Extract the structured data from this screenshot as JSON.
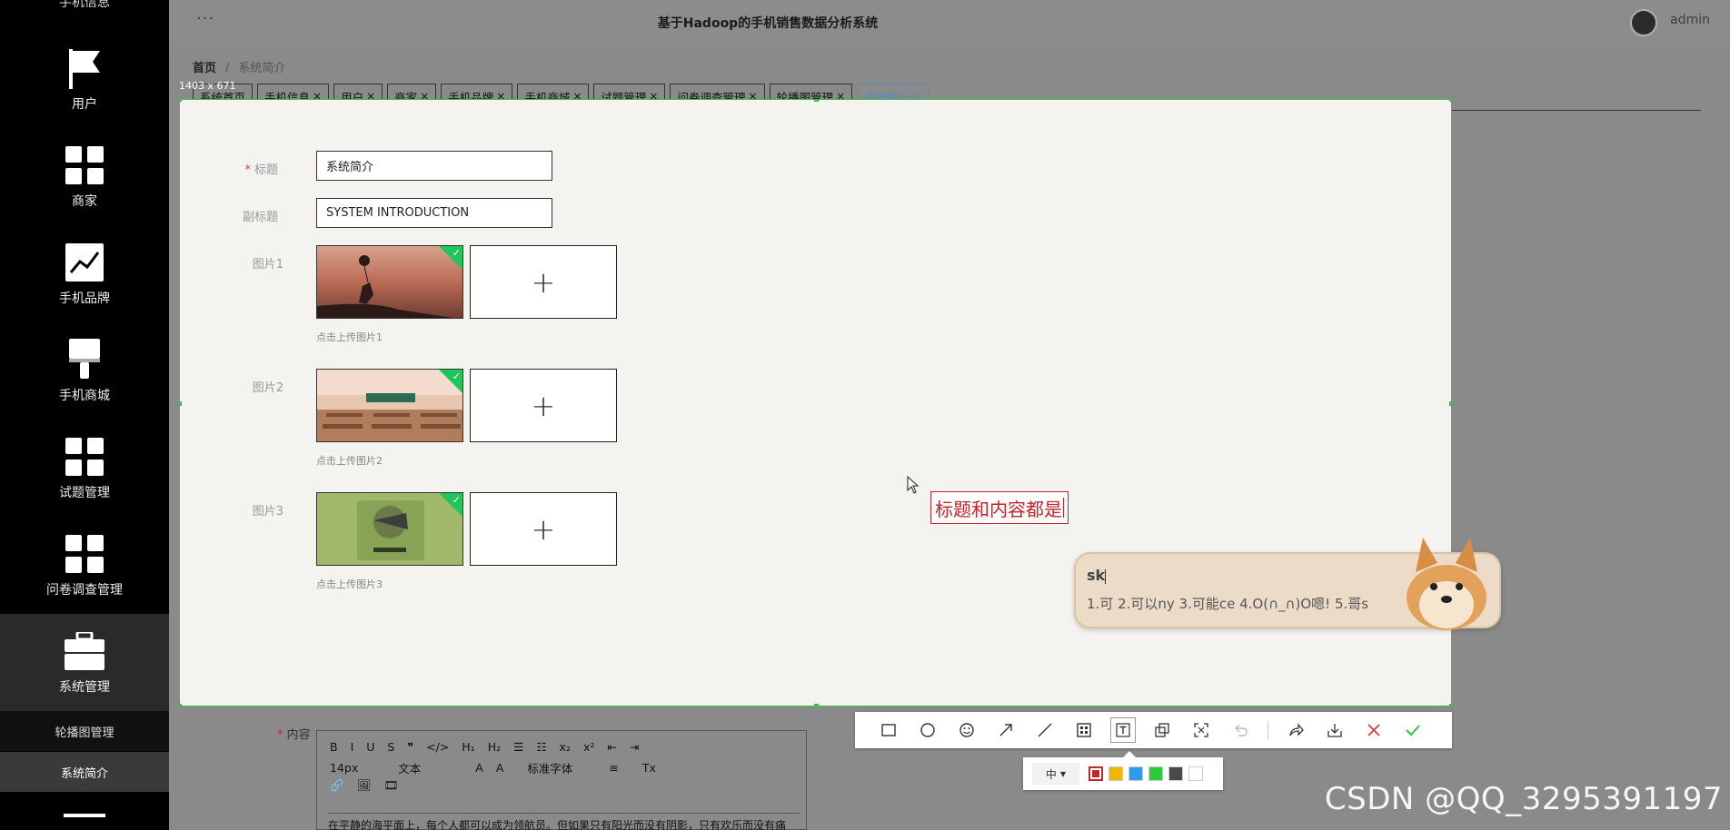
{
  "sidebar": {
    "top_cut_text": "手机信息",
    "items": [
      {
        "label": "用户",
        "icon": "flag-icon"
      },
      {
        "label": "商家",
        "icon": "grid-icon"
      },
      {
        "label": "手机品牌",
        "icon": "chart-icon"
      },
      {
        "label": "手机商城",
        "icon": "brush-icon"
      },
      {
        "label": "试题管理",
        "icon": "grid-icon"
      },
      {
        "label": "问卷调查管理",
        "icon": "grid-icon"
      },
      {
        "label": "系统管理",
        "icon": "briefcase-icon"
      }
    ],
    "subitems": [
      {
        "label": "轮播图管理"
      },
      {
        "label": "系统简介"
      }
    ]
  },
  "header": {
    "menu_dots": "···",
    "title": "基于Hadoop的手机销售数据分析系统",
    "user": "admin"
  },
  "breadcrumb": {
    "home": "首页",
    "sep": "/",
    "current": "系统简介"
  },
  "tabs": [
    {
      "label": "系统首页",
      "closable": false
    },
    {
      "label": "手机信息",
      "closable": true
    },
    {
      "label": "用户",
      "closable": true
    },
    {
      "label": "商家",
      "closable": true
    },
    {
      "label": "手机品牌",
      "closable": true
    },
    {
      "label": "手机商城",
      "closable": true
    },
    {
      "label": "试题管理",
      "closable": true
    },
    {
      "label": "问卷调查管理",
      "closable": true
    },
    {
      "label": "轮播图管理",
      "closable": true
    },
    {
      "label": "系统简介",
      "closable": true,
      "active": true
    }
  ],
  "close_glyph": "×",
  "selection_size": "1403 x 671",
  "form": {
    "title_label": "标题",
    "title_value": "系统简介",
    "subtitle_label": "副标题",
    "subtitle_value": "SYSTEM INTRODUCTION",
    "pictures": [
      {
        "label": "图片1",
        "hint": "点击上传图片1",
        "thumb": "silhouette-girl-balloon-sunset"
      },
      {
        "label": "图片2",
        "hint": "点击上传图片2",
        "thumb": "empty-classroom"
      },
      {
        "label": "图片3",
        "hint": "点击上传图片3",
        "thumb": "green-book-cover"
      }
    ],
    "plus": "+",
    "required_mark": "*",
    "content_label": "内容"
  },
  "annotation_text": "标题和内容都是",
  "ime": {
    "composition": "sk",
    "candidates": "1.可  2.可以ny  3.可能ce  4.O(∩_∩)O嗯!  5.哥s"
  },
  "editor": {
    "row1": [
      "B",
      "I",
      "U",
      "S",
      "❞",
      "</>",
      "H₁",
      "H₂",
      "☰",
      "☷",
      "x₂",
      "x²",
      "⇤",
      "⇥"
    ],
    "row2": [
      "14px",
      "文本",
      "A",
      "A",
      "标准字体",
      "≡",
      "Tx"
    ],
    "row3": [
      "🔗",
      "🖼",
      "🎞"
    ],
    "text": "在平静的海平面上，每个人都可以成为领航员。但如果只有阳光而没有阴影，只有欢乐而没有痛"
  },
  "snip_toolbar": {
    "tools": [
      "rect-icon",
      "ellipse-icon",
      "emoji-icon",
      "arrow-icon",
      "line-icon",
      "mosaic-icon",
      "text-icon",
      "pin-icon",
      "ocr-icon",
      "undo-icon",
      "share-icon",
      "save-icon",
      "cancel-icon",
      "confirm-icon"
    ],
    "font_size": "中",
    "colors": [
      "#c0282d",
      "#f5b400",
      "#2e9bf0",
      "#2ec93a",
      "#4a4a4a",
      "#ffffff"
    ]
  },
  "watermark": "CSDN @QQ_3295391197"
}
